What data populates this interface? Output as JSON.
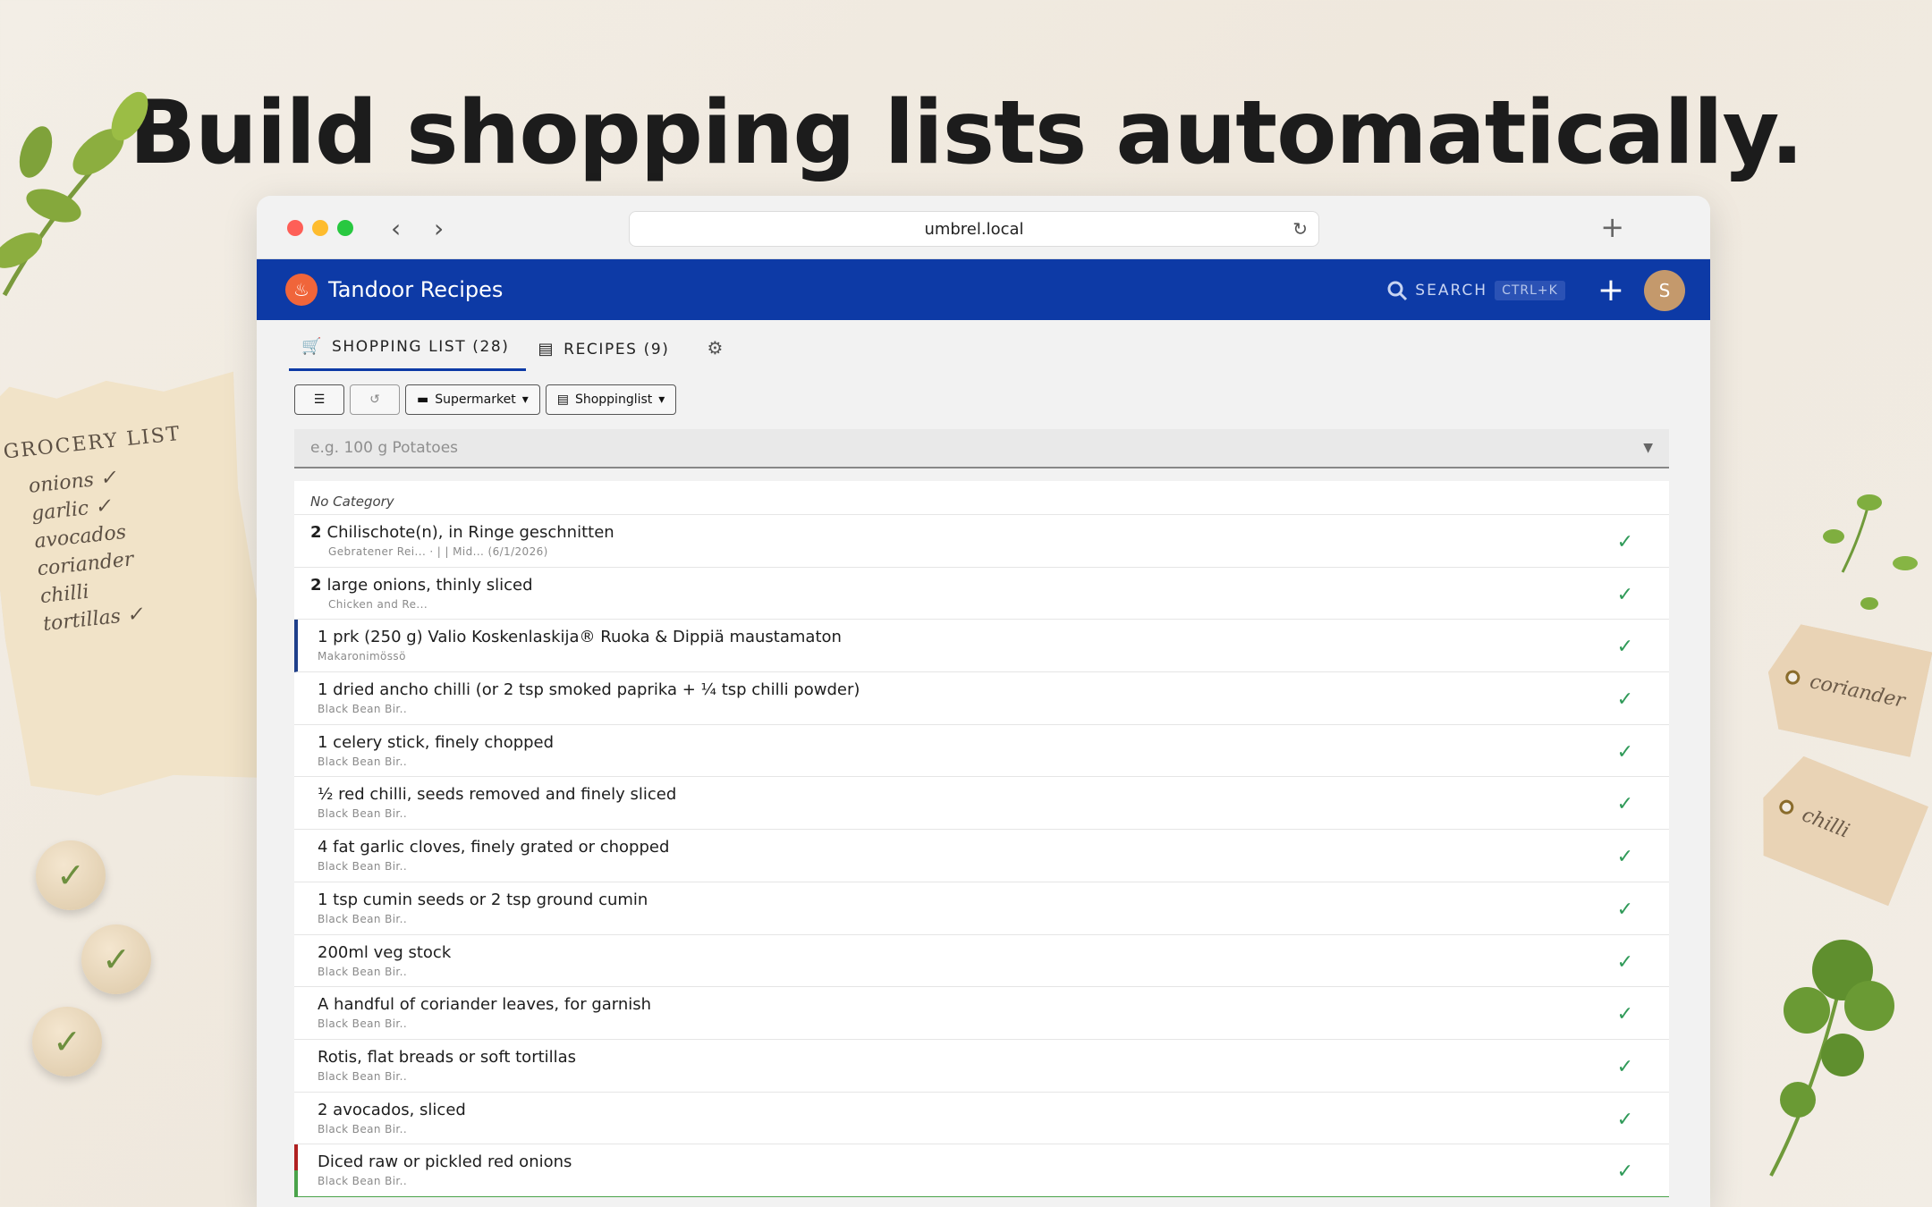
{
  "headline": "Build shopping lists automatically.",
  "decor": {
    "note_title": "GROCERY LIST",
    "note_items": [
      "onions ✓",
      "garlic ✓",
      "avocados",
      "coriander",
      "chilli",
      "tortillas ✓"
    ],
    "tags": [
      "coriander",
      "chilli"
    ],
    "coin_icon": "✓"
  },
  "browser": {
    "url": "umbrel.local",
    "back_icon": "‹",
    "forward_icon": "›",
    "reload_icon": "↻",
    "newtab_icon": "+"
  },
  "app": {
    "title": "Tandoor Recipes",
    "logo_icon": "♨",
    "search_label": "SEARCH",
    "search_shortcut": "CTRL+K",
    "add_icon": "+",
    "avatar_initial": "S",
    "brand_color": "#0d3aa6"
  },
  "tabs": [
    {
      "label": "SHOPPING LIST (28)",
      "icon": "🛒",
      "active": true
    },
    {
      "label": "RECIPES (9)",
      "icon": "▤",
      "active": false
    }
  ],
  "filter_icon": "⚙",
  "toolbar": {
    "list_icon": "☰",
    "undo_icon": "↺",
    "supermarket_label": "Supermarket",
    "shoppinglist_label": "Shoppinglist"
  },
  "add_input": {
    "placeholder": "e.g. 100 g Potatoes"
  },
  "list": {
    "category": "No Category",
    "check_icon": "✓",
    "items": [
      {
        "amount": "2",
        "text": "Chilischote(n), in Ringe geschnitten",
        "sub": "Gebratener Rei... · | | Mid... (6/1/2026)"
      },
      {
        "amount": "2",
        "text": "large onions, thinly sliced",
        "sub": "Chicken and Re..."
      },
      {
        "amount": "",
        "text": "1 prk (250 g) Valio Koskenlaskija® Ruoka & Dippiä maustamaton",
        "sub": "Makaronimössö"
      },
      {
        "amount": "",
        "text": "1 dried ancho chilli (or 2 tsp smoked paprika + ¼ tsp chilli powder)",
        "sub": "Black Bean Bir.."
      },
      {
        "amount": "",
        "text": "1 celery stick, finely chopped",
        "sub": "Black Bean Bir.."
      },
      {
        "amount": "",
        "text": "½ red chilli, seeds removed and finely sliced",
        "sub": "Black Bean Bir.."
      },
      {
        "amount": "",
        "text": "4 fat garlic cloves, finely grated or chopped",
        "sub": "Black Bean Bir.."
      },
      {
        "amount": "",
        "text": "1 tsp cumin seeds or 2 tsp ground cumin",
        "sub": "Black Bean Bir.."
      },
      {
        "amount": "",
        "text": "200ml veg stock",
        "sub": "Black Bean Bir.."
      },
      {
        "amount": "",
        "text": "A handful of coriander leaves, for garnish",
        "sub": "Black Bean Bir.."
      },
      {
        "amount": "",
        "text": "Rotis, flat breads or soft tortillas",
        "sub": "Black Bean Bir.."
      },
      {
        "amount": "",
        "text": "2 avocados, sliced",
        "sub": "Black Bean Bir.."
      },
      {
        "amount": "",
        "text": "Diced raw or pickled red onions",
        "sub": "Black Bean Bir.."
      }
    ]
  }
}
